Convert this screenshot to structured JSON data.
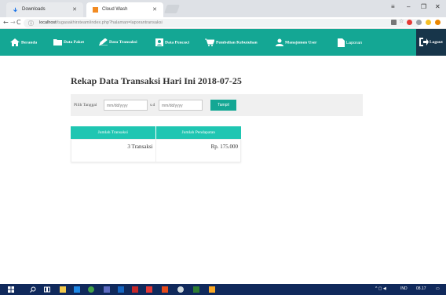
{
  "browser": {
    "tabs": [
      {
        "label": "Downloads"
      },
      {
        "label": "Cloud Wash"
      }
    ],
    "address": {
      "host": "localhost",
      "path": "/tugasakhirsteam/index.php?halaman=laporantransaksi"
    }
  },
  "navbar": {
    "items": [
      {
        "label": "Beranda"
      },
      {
        "label": "Data Paket"
      },
      {
        "label": "Data Transaksi"
      },
      {
        "label": "Data Pencuci"
      },
      {
        "label": "Pembelian Kebutuhan"
      },
      {
        "label": "Manajemen User"
      },
      {
        "label": "Laporan"
      }
    ],
    "logout_label": "Logout"
  },
  "main": {
    "title": "Rekap Data Transaksi Hari Ini 2018-07-25",
    "filter": {
      "label": "Pilih Tanggal",
      "date_from_placeholder": "mm/dd/yyyy",
      "between_label": "s.d",
      "date_to_placeholder": "mm/dd/yyyy",
      "button_label": "Tampil"
    },
    "table": {
      "headers": [
        "Jumlah Transaksi",
        "Jumlah Pendapatan"
      ],
      "row": [
        "3 Transaksi",
        "Rp. 175.000"
      ]
    }
  },
  "taskbar": {
    "tray_lang": "IND",
    "time": "08.17"
  },
  "colors": {
    "nav_bg": "#14a794",
    "table_header": "#1fc6b2",
    "logout_bg": "#17354a",
    "taskbar_bg": "#10295b"
  }
}
